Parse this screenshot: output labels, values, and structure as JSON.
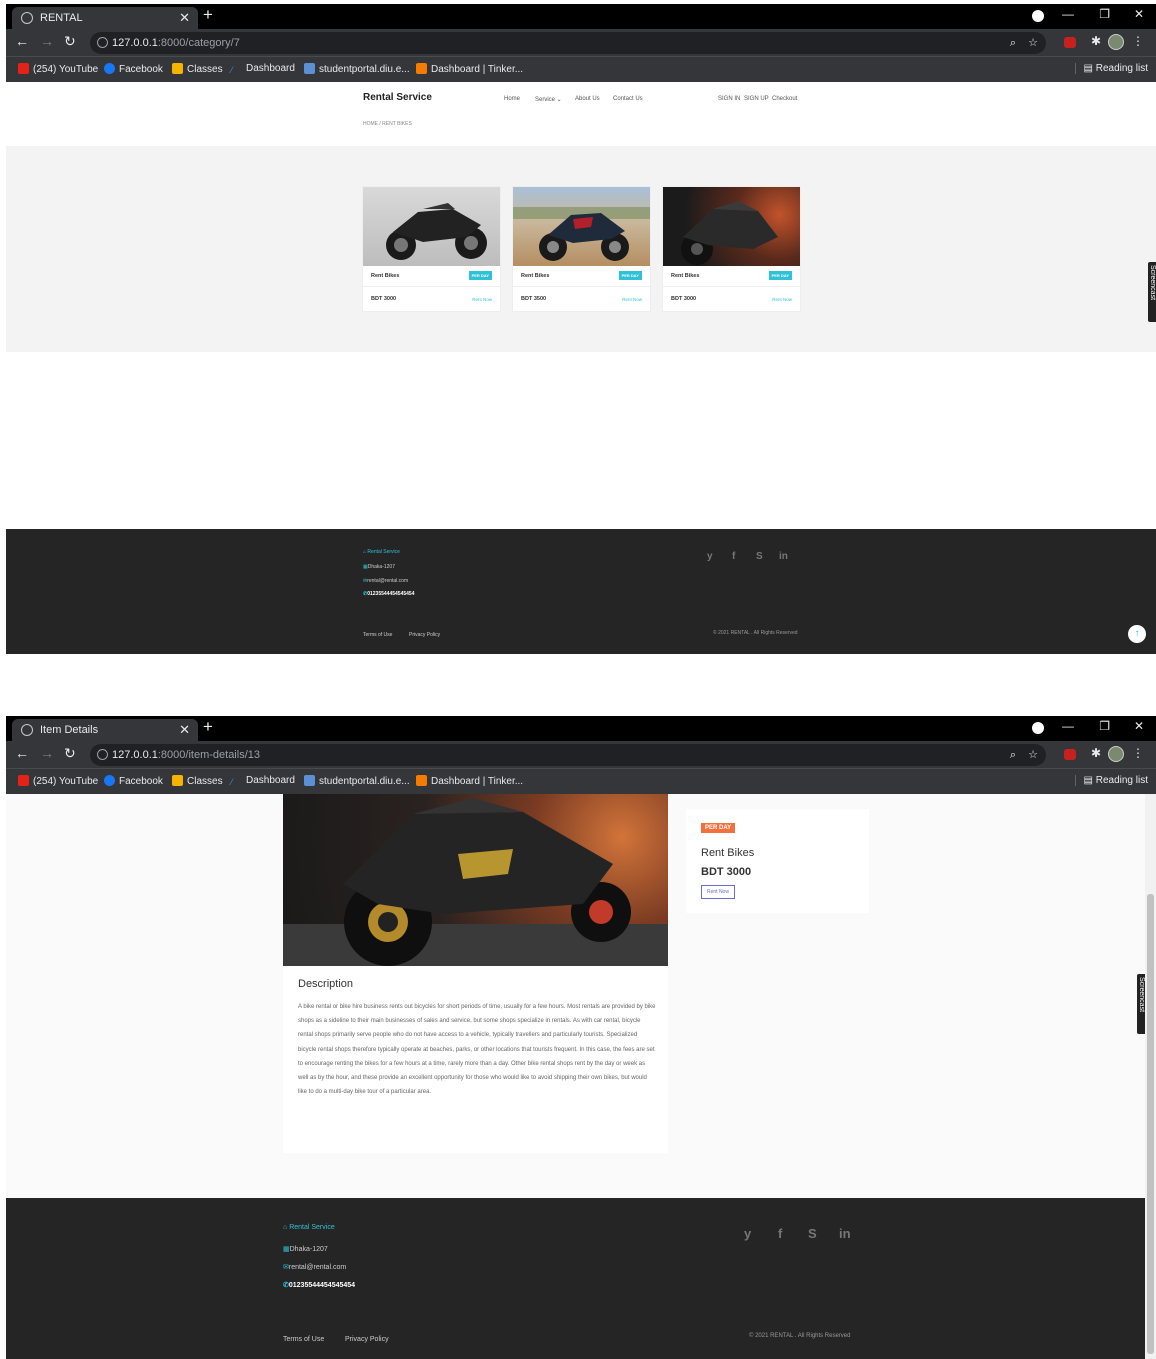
{
  "window1": {
    "tab_title": "RENTAL",
    "url_host": "127.0.0.1",
    "url_rest": ":8000/category/7",
    "bookmarks": [
      "(254) YouTube",
      "Facebook",
      "Classes",
      "Dashboard",
      "studentportal.diu.e...",
      "Dashboard | Tinker..."
    ],
    "reading_list": "Reading list",
    "site": {
      "brand": "Rental Service",
      "menu": [
        "Home",
        "Service ⌄",
        "About Us",
        "Contact Us"
      ],
      "auth": [
        "SIGN IN",
        "SIGN UP",
        "Checkout"
      ],
      "breadcrumb": "HOME / RENT BIKES"
    },
    "cards": [
      {
        "title": "Rent Bikes",
        "badge": "PER DAY",
        "price": "BDT 3000",
        "action": "Rent Now"
      },
      {
        "title": "Rent Bikes",
        "badge": "PER DAY",
        "price": "BDT 3500",
        "action": "Rent Now"
      },
      {
        "title": "Rent Bikes",
        "badge": "PER DAY",
        "price": "BDT 3000",
        "action": "Rent Now"
      }
    ],
    "footer": {
      "brand": "Rental Service",
      "address": "Dhaka-1207",
      "email": "rental@rental.com",
      "phone": "01235544454545454",
      "social": [
        "y",
        "f",
        "S",
        "in"
      ],
      "links": [
        "Terms of Use",
        "Privacy Policy"
      ],
      "copyright": "© 2021 RENTAL . All Rights Reserved"
    }
  },
  "window2": {
    "tab_title": "Item Details",
    "url_host": "127.0.0.1",
    "url_rest": ":8000/item-details/13",
    "bookmarks": [
      "(254) YouTube",
      "Facebook",
      "Classes",
      "Dashboard",
      "studentportal.diu.e...",
      "Dashboard | Tinker..."
    ],
    "reading_list": "Reading list",
    "item": {
      "badge": "PER DAY",
      "title": "Rent Bikes",
      "price": "BDT 3000",
      "action": "Rent Now"
    },
    "description": {
      "heading": "Description",
      "text": "A bike rental or bike hire business rents out bicycles for short periods of time, usually for a few hours. Most rentals are provided by bike shops as a sideline to their main businesses of sales and service, but some shops specialize in rentals. As with car rental, bicycle rental shops primarily serve people who do not have access to a vehicle, typically travellers and particularly tourists. Specialized bicycle rental shops therefore typically operate at beaches, parks, or other locations that tourists frequent. In this case, the fees are set to encourage renting the bikes for a few hours at a time, rarely more than a day. Other bike rental shops rent by the day or week as well as by the hour, and these provide an excellent opportunity for those who would like to avoid shipping their own bikes, but would like to do a multi-day bike tour of a particular area."
    },
    "footer": {
      "brand": "Rental Service",
      "address": "Dhaka-1207",
      "email": "rental@rental.com",
      "phone": "01235544454545454",
      "social": [
        "y",
        "f",
        "S",
        "in"
      ],
      "links": [
        "Terms of Use",
        "Privacy Policy"
      ],
      "copyright": "© 2021 RENTAL . All Rights Reserved"
    }
  },
  "extension_label": "Screencast",
  "colors": {
    "accent": "#2fc2d6",
    "badge_orange": "#f2703b",
    "footer_bg": "#252525"
  }
}
